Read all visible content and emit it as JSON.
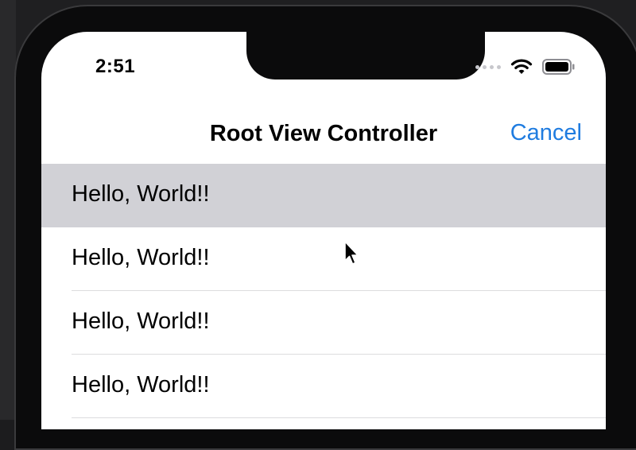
{
  "status_bar": {
    "time": "2:51"
  },
  "nav_bar": {
    "title": "Root View Controller",
    "cancel_label": "Cancel"
  },
  "rows": [
    {
      "label": "Hello, World!!",
      "selected": true
    },
    {
      "label": "Hello, World!!",
      "selected": false
    },
    {
      "label": "Hello, World!!",
      "selected": false
    },
    {
      "label": "Hello, World!!",
      "selected": false
    }
  ],
  "colors": {
    "tint": "#1f7ce0",
    "selected_row": "#d1d1d6",
    "frame": "#0b0b0c"
  },
  "icons": [
    "signal-dots-icon",
    "wifi-icon",
    "battery-icon",
    "pointer-cursor-icon"
  ]
}
